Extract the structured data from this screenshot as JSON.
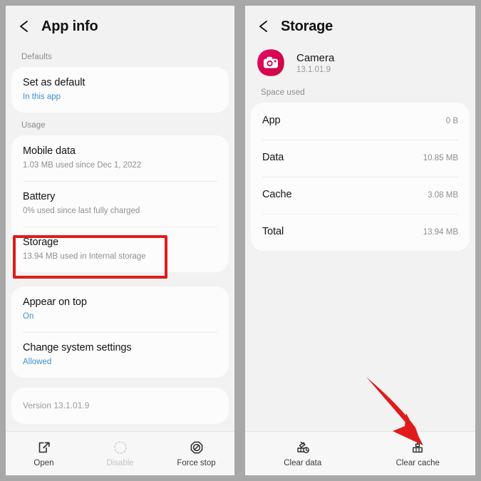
{
  "left_screen": {
    "title": "App info",
    "back_icon": "chevron-left-icon",
    "sections": [
      {
        "label": "Defaults",
        "rows": [
          {
            "title": "Set as default",
            "sub": "In this app",
            "sub_is_link": true
          }
        ]
      },
      {
        "label": "Usage",
        "rows": [
          {
            "title": "Mobile data",
            "sub": "1.03 MB used since Dec 1, 2022",
            "sub_is_link": false
          },
          {
            "title": "Battery",
            "sub": "0% used since last fully charged",
            "sub_is_link": false
          },
          {
            "title": "Storage",
            "sub": "13.94 MB used in Internal storage",
            "sub_is_link": false
          }
        ]
      },
      {
        "label": "",
        "rows": [
          {
            "title": "Appear on top",
            "sub": "On",
            "sub_is_link": true
          },
          {
            "title": "Change system settings",
            "sub": "Allowed",
            "sub_is_link": true
          }
        ]
      }
    ],
    "version_text": "Version 13.1.01.9",
    "bottom_bar": [
      {
        "label": "Open",
        "icon": "open-external-icon",
        "disabled": false
      },
      {
        "label": "Disable",
        "icon": "disable-dashed-circle-icon",
        "disabled": true
      },
      {
        "label": "Force stop",
        "icon": "force-stop-icon",
        "disabled": false
      }
    ]
  },
  "right_screen": {
    "title": "Storage",
    "back_icon": "chevron-left-icon",
    "app": {
      "name": "Camera",
      "version": "13.1.01.9",
      "icon": "camera-app-icon"
    },
    "section_label": "Space used",
    "space_rows": [
      {
        "label": "App",
        "value": "0 B"
      },
      {
        "label": "Data",
        "value": "10.85 MB"
      },
      {
        "label": "Cache",
        "value": "3.08 MB"
      },
      {
        "label": "Total",
        "value": "13.94 MB"
      }
    ],
    "bottom_bar": [
      {
        "label": "Clear data",
        "icon": "clear-data-broom-icon",
        "disabled": false
      },
      {
        "label": "Clear cache",
        "icon": "clear-cache-broom-icon",
        "disabled": false
      }
    ]
  },
  "annotations": {
    "highlight_color": "#e01b1b",
    "arrow_color": "#e01b1b",
    "highlight_target": "Storage",
    "arrow_target": "Clear cache"
  }
}
